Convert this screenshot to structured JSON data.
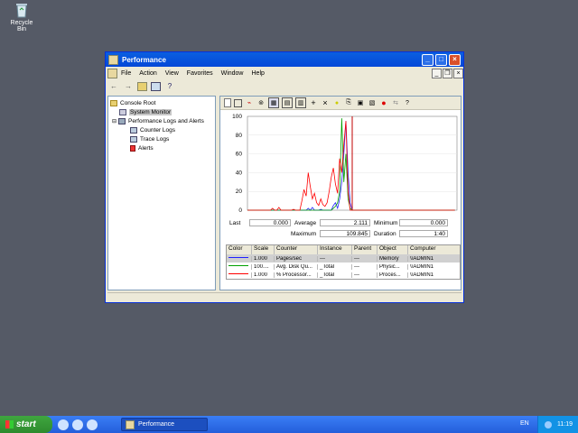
{
  "desktop": {
    "icons": [
      {
        "label": "Recycle Bin"
      }
    ]
  },
  "window": {
    "title": "Performance",
    "menu": [
      "File",
      "Action",
      "View",
      "Favorites",
      "Window",
      "Help"
    ]
  },
  "tree": {
    "items": [
      {
        "label": "Console Root",
        "level": 0
      },
      {
        "label": "System Monitor",
        "level": 1,
        "selected": true
      },
      {
        "label": "Performance Logs and Alerts",
        "level": 1
      },
      {
        "label": "Counter Logs",
        "level": 2
      },
      {
        "label": "Trace Logs",
        "level": 2
      },
      {
        "label": "Alerts",
        "level": 2
      }
    ]
  },
  "chart_data": {
    "type": "line",
    "ylim": [
      0,
      100
    ],
    "yticks": [
      "100",
      "80",
      "60",
      "40",
      "20",
      "0"
    ],
    "x": [
      0,
      1,
      2,
      3,
      4,
      5,
      6,
      7,
      8,
      9,
      10,
      11,
      12,
      13,
      14,
      15,
      16,
      17,
      18,
      19,
      20,
      21,
      22,
      23,
      24,
      25,
      26,
      27,
      28,
      29,
      30,
      31,
      32,
      33,
      34,
      35,
      36,
      37,
      38,
      39,
      40,
      41,
      42,
      43,
      44,
      45,
      46,
      47,
      48,
      49,
      50,
      51,
      52,
      53,
      54,
      55,
      56,
      57,
      58,
      59,
      60,
      61,
      62,
      63,
      64,
      65,
      66,
      67,
      68,
      69,
      70,
      71,
      72,
      73,
      74,
      75,
      76,
      77,
      78,
      79,
      80,
      81,
      82,
      83,
      84,
      85,
      86,
      87,
      88,
      89,
      90,
      91,
      92,
      93,
      94,
      95,
      96,
      97,
      98,
      99
    ],
    "series": [
      {
        "name": "Pages/sec",
        "color": "#2020ff",
        "values": [
          0,
          0,
          0,
          0,
          0,
          0,
          0,
          0,
          0,
          0,
          0,
          0,
          0,
          0,
          0,
          0,
          0,
          0,
          0,
          0,
          0,
          0,
          0,
          0,
          0,
          0,
          0,
          0,
          0,
          2,
          0,
          3,
          0,
          0,
          0,
          1,
          0,
          0,
          0,
          0,
          0,
          5,
          8,
          2,
          12,
          30,
          60,
          95,
          40,
          8,
          0,
          0,
          0,
          0,
          0,
          0,
          0,
          0,
          0,
          0,
          0,
          0,
          0,
          0,
          0,
          0,
          0,
          0,
          0,
          0,
          0,
          0,
          0,
          0,
          0,
          0,
          0,
          0,
          0,
          0,
          0,
          0,
          0,
          0,
          0,
          0,
          0,
          0,
          0,
          0,
          0,
          0,
          0,
          0,
          0,
          0,
          0,
          0,
          0,
          0
        ]
      },
      {
        "name": "Avg. Disk Qu...",
        "color": "#00a000",
        "values": [
          0,
          0,
          0,
          0,
          0,
          0,
          0,
          0,
          0,
          0,
          0,
          0,
          0,
          0,
          0,
          0,
          0,
          0,
          0,
          0,
          0,
          0,
          0,
          0,
          0,
          0,
          0,
          0,
          0,
          0,
          0,
          0,
          0,
          0,
          0,
          0,
          0,
          0,
          0,
          0,
          0,
          2,
          4,
          8,
          20,
          98,
          30,
          60,
          12,
          2,
          0,
          0,
          0,
          0,
          0,
          0,
          0,
          0,
          0,
          0,
          0,
          0,
          0,
          0,
          0,
          0,
          0,
          0,
          0,
          0,
          0,
          0,
          0,
          0,
          0,
          0,
          0,
          0,
          0,
          0,
          0,
          0,
          0,
          0,
          0,
          0,
          0,
          0,
          0,
          0,
          0,
          0,
          0,
          0,
          0,
          0,
          0,
          0,
          0,
          0
        ]
      },
      {
        "name": "% Processor...",
        "color": "#ff0000",
        "values": [
          0,
          0,
          0,
          0,
          0,
          0,
          0,
          0,
          0,
          0,
          0,
          0,
          2,
          0,
          0,
          3,
          0,
          0,
          0,
          0,
          0,
          0,
          1,
          0,
          0,
          0,
          10,
          22,
          15,
          40,
          25,
          12,
          18,
          8,
          5,
          12,
          6,
          4,
          8,
          20,
          35,
          45,
          28,
          18,
          55,
          40,
          70,
          95,
          20,
          0,
          0,
          0,
          0,
          0,
          0,
          0,
          0,
          0,
          0,
          0,
          0,
          0,
          0,
          0,
          0,
          0,
          0,
          0,
          0,
          0,
          0,
          0,
          0,
          0,
          0,
          0,
          0,
          0,
          0,
          0,
          0,
          0,
          0,
          0,
          0,
          0,
          0,
          0,
          0,
          0,
          0,
          0,
          0,
          0,
          0,
          0,
          0,
          0,
          0,
          0
        ]
      }
    ],
    "cursor_x": 50
  },
  "stats": {
    "last_label": "Last",
    "last": "0.000",
    "average_label": "Average",
    "average": "2.111",
    "minimum_label": "Minimum",
    "minimum": "0.000",
    "maximum_label": "Maximum",
    "maximum": "109.845",
    "duration_label": "Duration",
    "duration": "1:40"
  },
  "legend": {
    "headers": [
      "Color",
      "Scale",
      "Counter",
      "Instance",
      "Parent",
      "Object",
      "Computer"
    ],
    "rows": [
      {
        "color": "#2020ff",
        "scale": "1.000",
        "counter": "Pages/sec",
        "instance": "---",
        "parent": "---",
        "object": "Memory",
        "computer": "\\\\ADMIN1"
      },
      {
        "color": "#00a000",
        "scale": "100....",
        "counter": "Avg. Disk Qu...",
        "instance": "_Total",
        "parent": "---",
        "object": "Physic...",
        "computer": "\\\\ADMIN1"
      },
      {
        "color": "#ff0000",
        "scale": "1.000",
        "counter": "% Processor...",
        "instance": "_Total",
        "parent": "---",
        "object": "Proces...",
        "computer": "\\\\ADMIN1"
      }
    ]
  },
  "taskbar": {
    "start": "start",
    "task": "Performance",
    "lang": "EN",
    "clock": "11:19"
  }
}
